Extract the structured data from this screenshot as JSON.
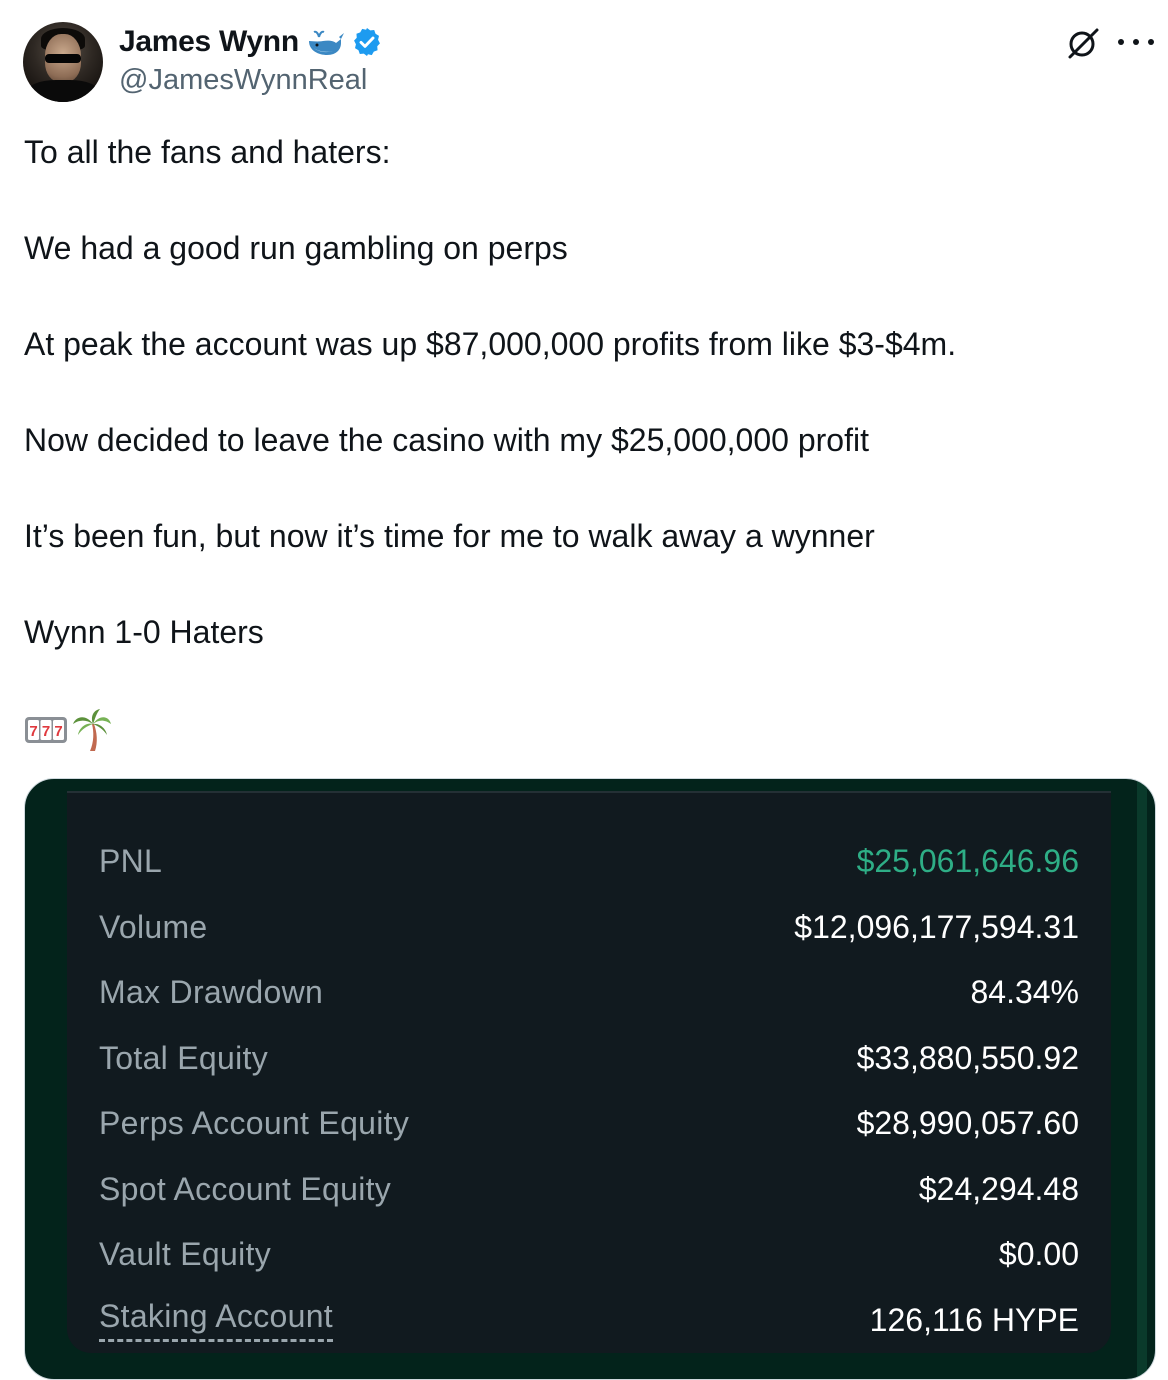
{
  "author": {
    "name": "James Wynn",
    "handle": "@JamesWynnReal",
    "badge_icon": "whale-emoji",
    "verified_icon": "verified-badge",
    "verified_color": "#1d9bf0"
  },
  "header_actions": {
    "grok_icon": "grok-icon",
    "more_icon": "more-options-icon"
  },
  "tweet": {
    "lines": [
      "To all the fans and haters:",
      "We had a good run gambling on perps",
      "At peak the account was up $87,000,000 profits from like $3-$4m.",
      "Now decided to leave the casino with my $25,000,000 profit",
      "It’s been fun, but now it’s time for me to walk away a wynner",
      "Wynn 1-0 Haters"
    ],
    "emojis": [
      "slot-machine-emoji",
      "palm-tree-emoji"
    ]
  },
  "screenshot_card": {
    "accent_color": "#2eae86",
    "rows": [
      {
        "label": "PNL",
        "value": "$25,061,646.96"
      },
      {
        "label": "Volume",
        "value": "$12,096,177,594.31"
      },
      {
        "label": "Max Drawdown",
        "value": "84.34%"
      },
      {
        "label": "Total Equity",
        "value": "$33,880,550.92"
      },
      {
        "label": "Perps Account Equity",
        "value": "$28,990,057.60"
      },
      {
        "label": "Spot Account Equity",
        "value": "$24,294.48"
      },
      {
        "label": "Vault Equity",
        "value": "$0.00"
      },
      {
        "label": "Staking Account",
        "value": "126,116 HYPE"
      }
    ]
  }
}
